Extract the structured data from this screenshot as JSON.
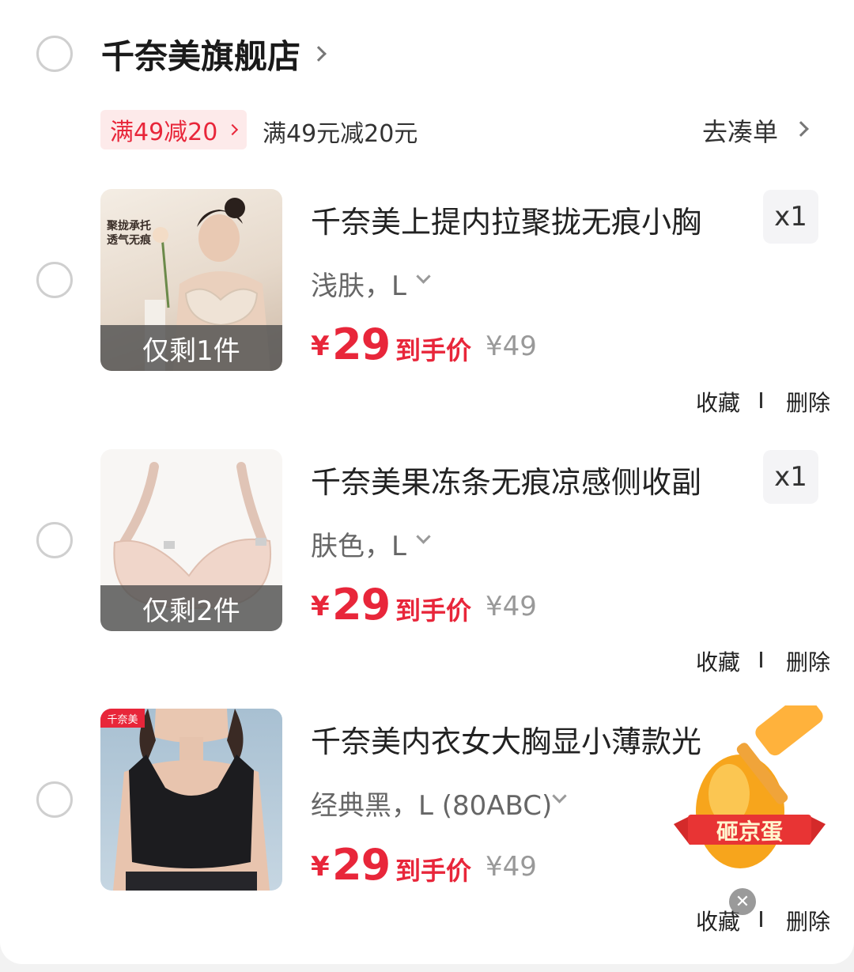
{
  "store": {
    "name": "千奈美旗舰店",
    "promo_tag": "满49减20",
    "promo_desc": "满49元减20元",
    "go_order": "去凑单"
  },
  "items": [
    {
      "title": "千奈美上提内拉聚拢无痕小胸",
      "spec": "浅肤，L",
      "stock": "仅剩1件",
      "currency": "¥",
      "price": "29",
      "price_label": "到手价",
      "original_price": "¥49",
      "qty": "x1",
      "image_caption": "聚拢承托\n透气无痕",
      "fav": "收藏",
      "del": "删除"
    },
    {
      "title": "千奈美果冻条无痕凉感侧收副",
      "spec": "肤色，L",
      "stock": "仅剩2件",
      "currency": "¥",
      "price": "29",
      "price_label": "到手价",
      "original_price": "¥49",
      "qty": "x1",
      "fav": "收藏",
      "del": "删除"
    },
    {
      "title": "千奈美内衣女大胸显小薄款光",
      "spec": "经典黑，L (80ABC)",
      "currency": "¥",
      "price": "29",
      "price_label": "到手价",
      "original_price": "¥49",
      "image_logo": "千奈美",
      "fav": "收藏",
      "del": "删除"
    }
  ],
  "floating_badge": {
    "label": "砸京蛋",
    "icon": "hammer-egg-icon",
    "close_glyph": "✕"
  },
  "colors": {
    "accent": "#e8263a",
    "promo_bg": "#fdeaea",
    "gray_text": "#999999"
  }
}
